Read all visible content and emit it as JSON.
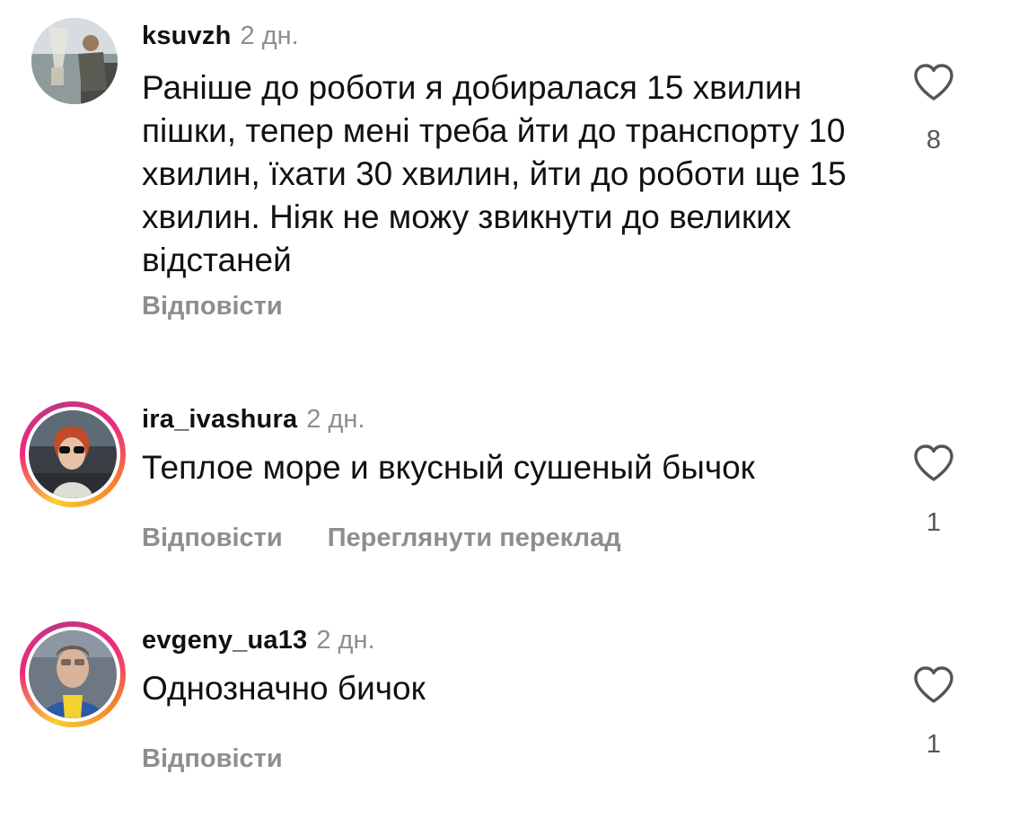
{
  "comments": [
    {
      "username": "ksuvzh",
      "time": "2 дн.",
      "text": "Раніше до роботи я добиралася 15 хвилин пішки, тепер мені треба йти до транспорту 10 хвилин, їхати 30 хвилин, йти до роботи ще 15 хвилин. Ніяк не можу звикнути до великих відстаней",
      "reply_label": "Відповісти",
      "likes": "8",
      "has_story_ring": false
    },
    {
      "username": "ira_ivashura",
      "time": "2 дн.",
      "text": "Теплое море и вкусный сушеный бычок",
      "reply_label": "Відповісти",
      "translate_label": "Переглянути переклад",
      "likes": "1",
      "has_story_ring": true
    },
    {
      "username": "evgeny_ua13",
      "time": "2 дн.",
      "text": "Однозначно бичок",
      "reply_label": "Відповісти",
      "likes": "1",
      "has_story_ring": true
    }
  ],
  "icons": {
    "like": "heart-outline-icon"
  },
  "colors": {
    "muted_text": "#8e8e8e",
    "story_ring": [
      "#f9ce34",
      "#ee2a7b",
      "#c13584"
    ]
  }
}
